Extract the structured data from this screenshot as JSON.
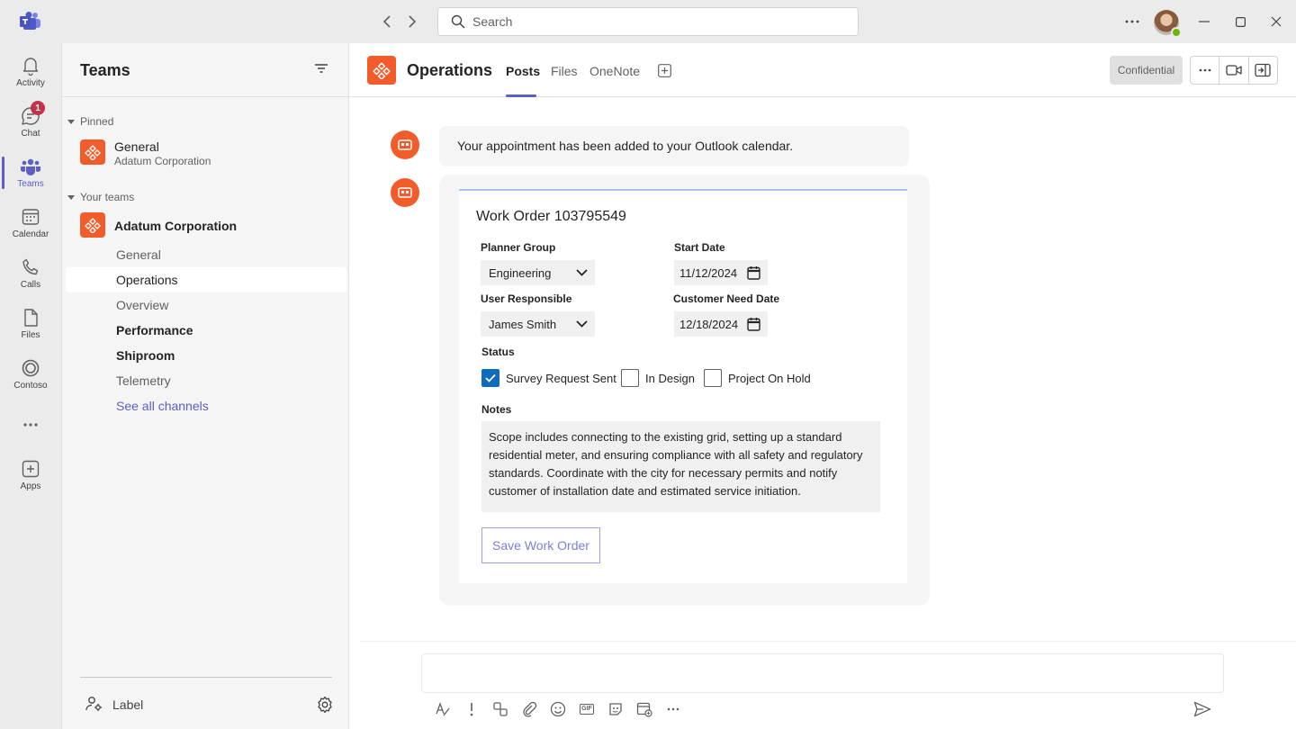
{
  "titlebar": {
    "search_placeholder": "Search"
  },
  "rail": {
    "items": [
      {
        "label": "Activity",
        "icon": "bell-icon"
      },
      {
        "label": "Chat",
        "icon": "chat-icon",
        "badge": "1"
      },
      {
        "label": "Teams",
        "icon": "teams-icon",
        "active": true
      },
      {
        "label": "Calendar",
        "icon": "calendar-icon"
      },
      {
        "label": "Calls",
        "icon": "phone-icon"
      },
      {
        "label": "Files",
        "icon": "file-icon"
      },
      {
        "label": "Contoso",
        "icon": "contoso-icon"
      },
      {
        "label": "",
        "icon": "more-icon"
      },
      {
        "label": "Apps",
        "icon": "add-app-icon"
      }
    ]
  },
  "teams_pane": {
    "title": "Teams",
    "pinned_label": "Pinned",
    "pinned": {
      "name": "General",
      "subtitle": "Adatum Corporation"
    },
    "your_teams_label": "Your teams",
    "team": {
      "name": "Adatum Corporation",
      "channels": [
        {
          "name": "General",
          "style": "normal"
        },
        {
          "name": "Operations",
          "style": "active"
        },
        {
          "name": "Overview",
          "style": "normal"
        },
        {
          "name": "Performance",
          "style": "bold"
        },
        {
          "name": "Shiproom",
          "style": "bold"
        },
        {
          "name": "Telemetry",
          "style": "normal"
        },
        {
          "name": "See all channels",
          "style": "link"
        }
      ]
    },
    "footer_label": "Label"
  },
  "channel_header": {
    "title": "Operations",
    "tabs": [
      {
        "label": "Posts",
        "active": true
      },
      {
        "label": "Files",
        "active": false
      },
      {
        "label": "OneNote",
        "active": false
      }
    ],
    "confidential_label": "Confidential"
  },
  "messages": {
    "confirmation": "Your appointment has been added to your Outlook calendar."
  },
  "work_order": {
    "title": "Work Order 103795549",
    "planner_group_label": "Planner Group",
    "planner_group_value": "Engineering",
    "start_date_label": "Start Date",
    "start_date_value": "11/12/2024",
    "user_responsible_label": "User Responsible",
    "user_responsible_value": "James Smith",
    "customer_need_date_label": "Customer Need Date",
    "customer_need_date_value": "12/18/2024",
    "status_label": "Status",
    "status_options": [
      {
        "label": "Survey Request Sent",
        "checked": true
      },
      {
        "label": "In Design",
        "checked": false
      },
      {
        "label": "Project On Hold",
        "checked": false
      }
    ],
    "notes_label": "Notes",
    "notes_value": "Scope includes connecting to the existing grid, setting up a standard residential meter, and ensuring compliance with all safety and regulatory standards. Coordinate with the city for necessary permits and notify customer of installation date and estimated service initiation.",
    "save_label": "Save Work Order"
  },
  "colors": {
    "accent": "#5b5fc7",
    "brand_orange": "#f25c2a",
    "checkbox_blue": "#0f6cbd",
    "badge_red": "#c4314b"
  }
}
